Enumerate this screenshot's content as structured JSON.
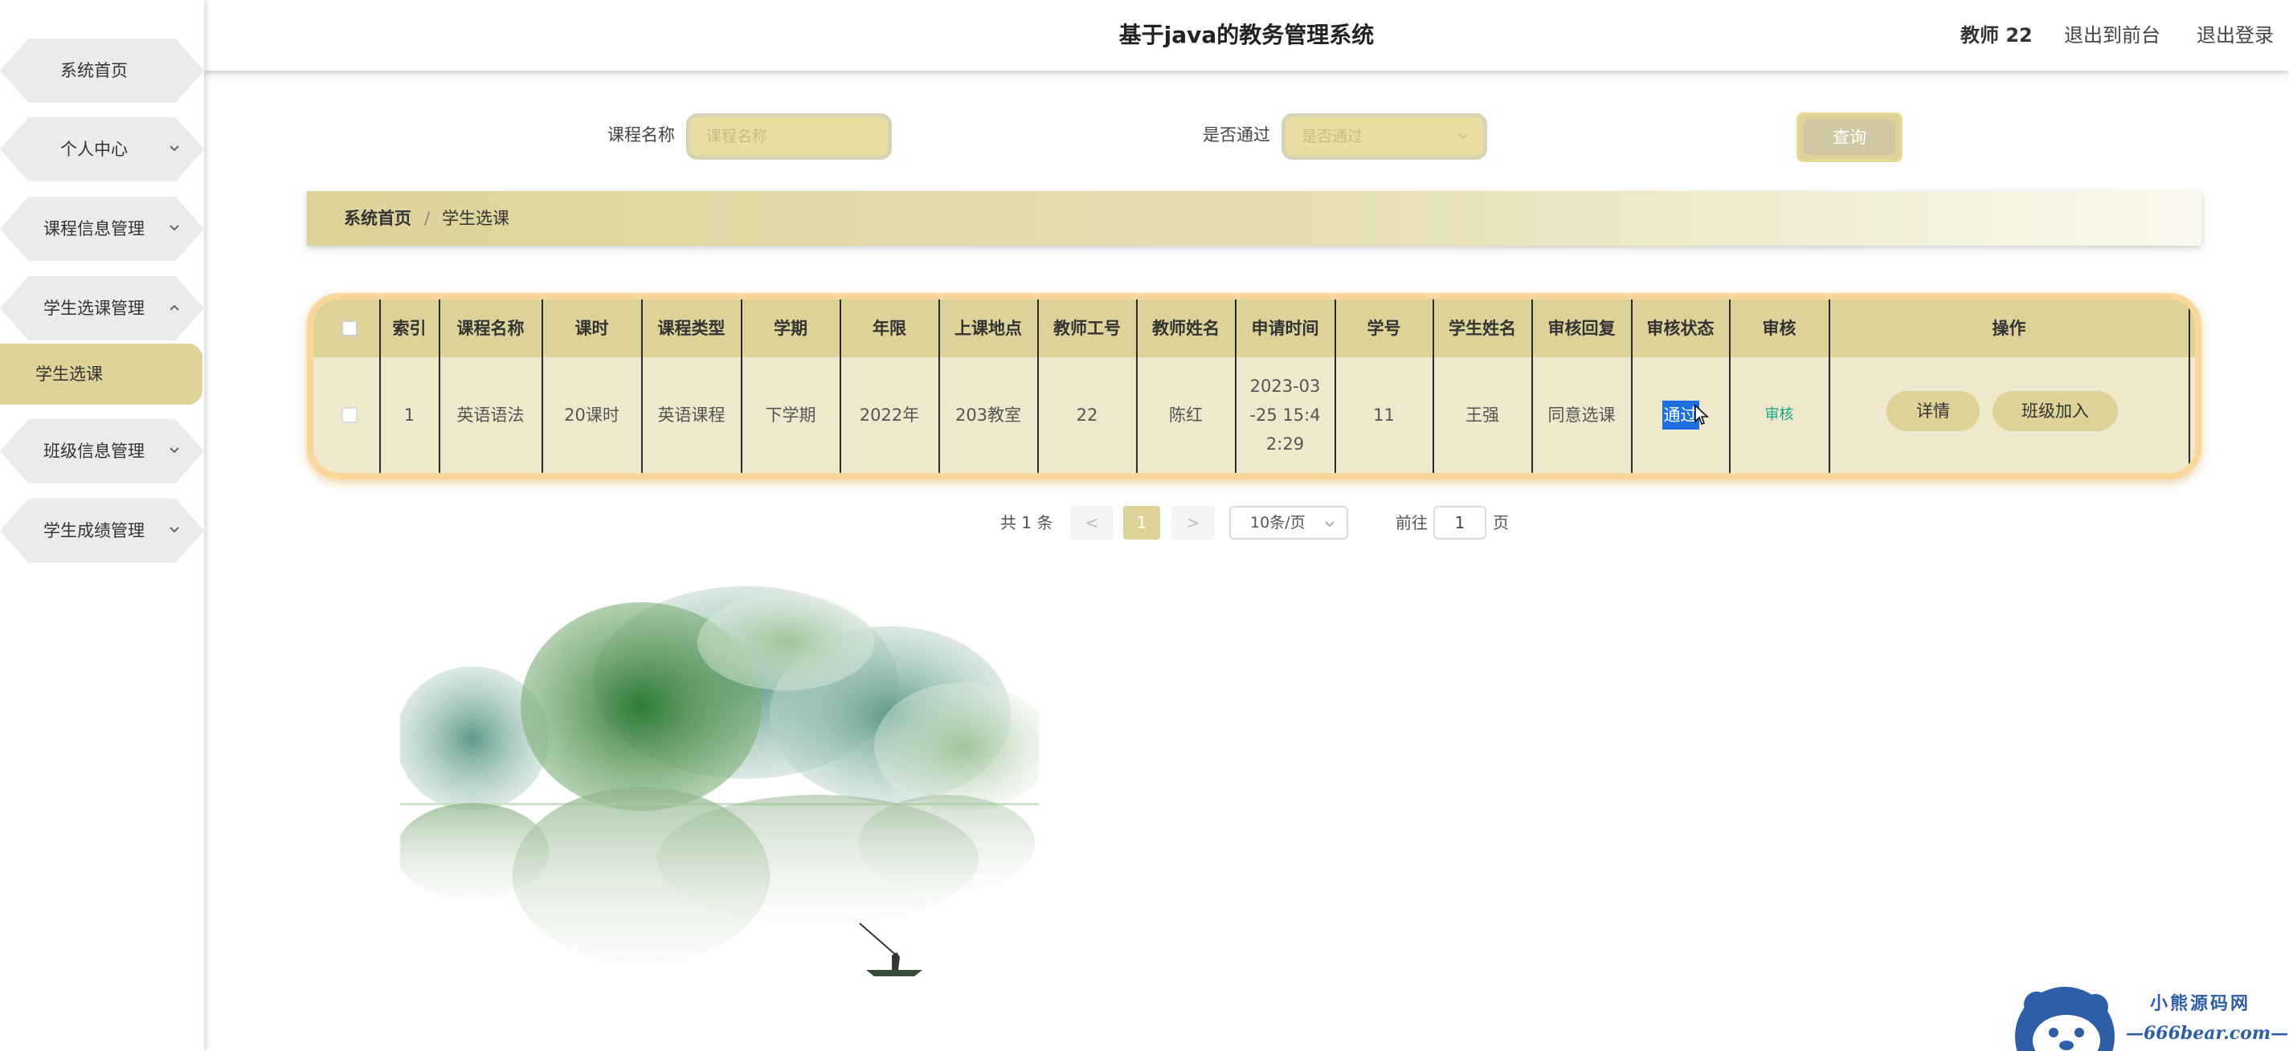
{
  "app": {
    "title": "基于java的教务管理系统"
  },
  "header": {
    "user": "教师 22",
    "front_link": "退出到前台",
    "logout_link": "退出登录"
  },
  "sidebar": {
    "items": [
      {
        "label": "系统首页"
      },
      {
        "label": "个人中心"
      },
      {
        "label": "课程信息管理"
      },
      {
        "label": "学生选课管理"
      },
      {
        "label": "班级信息管理"
      },
      {
        "label": "学生成绩管理"
      }
    ],
    "active_sub": "学生选课"
  },
  "search": {
    "course_label": "课程名称",
    "course_placeholder": "课程名称",
    "pass_label": "是否通过",
    "pass_placeholder": "是否通过",
    "query_button": "查询"
  },
  "breadcrumb": {
    "home": "系统首页",
    "separator": "/",
    "current": "学生选课"
  },
  "table": {
    "headers": [
      "索引",
      "课程名称",
      "课时",
      "课程类型",
      "学期",
      "年限",
      "上课地点",
      "教师工号",
      "教师姓名",
      "申请时间",
      "学号",
      "学生姓名",
      "审核回复",
      "审核状态",
      "审核",
      "操作"
    ],
    "rows": [
      {
        "index": "1",
        "course": "英语语法",
        "hours": "20课时",
        "type": "英语课程",
        "term": "下学期",
        "year": "2022年",
        "place": "203教室",
        "teacher_id": "22",
        "teacher_name": "陈红",
        "apply_time_1": "2023-03",
        "apply_time_2": "-25 15:4",
        "apply_time_3": "2:29",
        "student_id": "11",
        "student_name": "王强",
        "reply": "同意选课",
        "status": "通过",
        "review": "审核",
        "detail_button": "详情",
        "join_button": "班级加入"
      }
    ]
  },
  "pagination": {
    "total": "共 1 条",
    "prev": "<",
    "current_page": "1",
    "next": ">",
    "page_size": "10条/页",
    "goto_label": "前往",
    "goto_value": "1",
    "page_unit": "页"
  },
  "watermark": {
    "cn": "小熊源码网",
    "en": "—666bear.com—"
  },
  "colors": {
    "accent": "#ddd399",
    "table_border": "#f9d79a",
    "review_link": "#11a985"
  }
}
